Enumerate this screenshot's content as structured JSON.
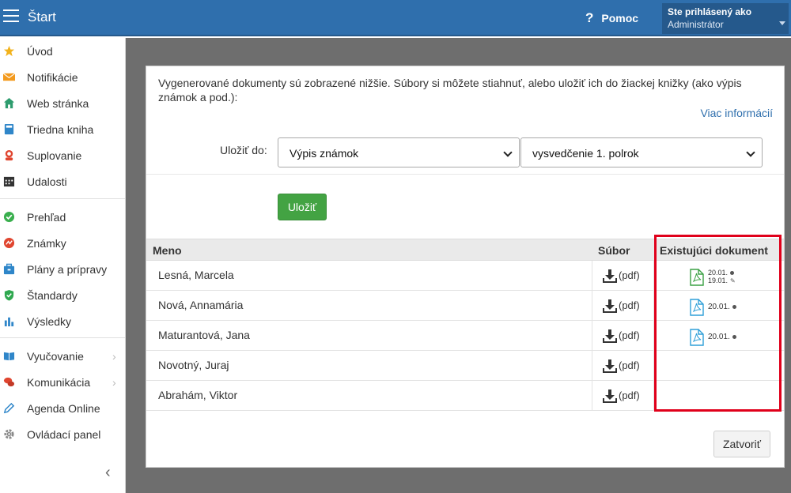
{
  "header": {
    "app_title": "Štart",
    "help_label": "Pomoc",
    "user_line1": "Ste prihlásený ako",
    "user_line2": "Administrátor"
  },
  "sidebar": {
    "items": [
      {
        "label": "Úvod",
        "icon": "star-icon"
      },
      {
        "label": "Notifikácie",
        "icon": "envelope-icon"
      },
      {
        "label": "Web stránka",
        "icon": "home-icon"
      },
      {
        "label": "Triedna kniha",
        "icon": "book-icon"
      },
      {
        "label": "Suplovanie",
        "icon": "substitute-icon"
      },
      {
        "label": "Udalosti",
        "icon": "calendar-icon"
      },
      {
        "label": "Prehľad",
        "icon": "check-circle-icon"
      },
      {
        "label": "Známky",
        "icon": "grades-icon"
      },
      {
        "label": "Plány a prípravy",
        "icon": "briefcase-icon"
      },
      {
        "label": "Štandardy",
        "icon": "shield-check-icon"
      },
      {
        "label": "Výsledky",
        "icon": "bar-chart-icon"
      },
      {
        "label": "Vyučovanie",
        "icon": "open-book-icon"
      },
      {
        "label": "Komunikácia",
        "icon": "chat-icon"
      },
      {
        "label": "Agenda Online",
        "icon": "pen-icon"
      },
      {
        "label": "Ovládací panel",
        "icon": "gear-icon"
      }
    ]
  },
  "panel": {
    "intro": "Vygenerované dokumenty sú zobrazené nižšie. Súbory si môžete stiahnuť, alebo uložiť ich do žiackej knižky (ako výpis známok a pod.):",
    "more_info": "Viac informácií",
    "save_to_label": "Uložiť do:",
    "select_type": "Výpis známok",
    "select_period": "vysvedčenie 1. polrok",
    "save_button": "Uložiť",
    "close_button": "Zatvoriť"
  },
  "table": {
    "headers": {
      "name": "Meno",
      "file": "Súbor",
      "existing": "Existujúci dokument"
    },
    "download_label": "(pdf)",
    "rows": [
      {
        "name": "Lesná, Marcela",
        "doc_color": "#3aa043",
        "date1": "20.01.",
        "date2": "19.01."
      },
      {
        "name": "Nová, Annamária",
        "doc_color": "#2f9fd8",
        "date1": "20.01.",
        "date2": null
      },
      {
        "name": "Maturantová, Jana",
        "doc_color": "#2f9fd8",
        "date1": "20.01.",
        "date2": null
      },
      {
        "name": "Novotný, Juraj",
        "doc_color": null,
        "date1": null,
        "date2": null
      },
      {
        "name": "Abrahám, Viktor",
        "doc_color": null,
        "date1": null,
        "date2": null
      }
    ]
  },
  "colors": {
    "topbar": "#2f6fad",
    "accent_link": "#2f6fad",
    "save_button": "#43a343",
    "highlight": "#e0001b"
  }
}
